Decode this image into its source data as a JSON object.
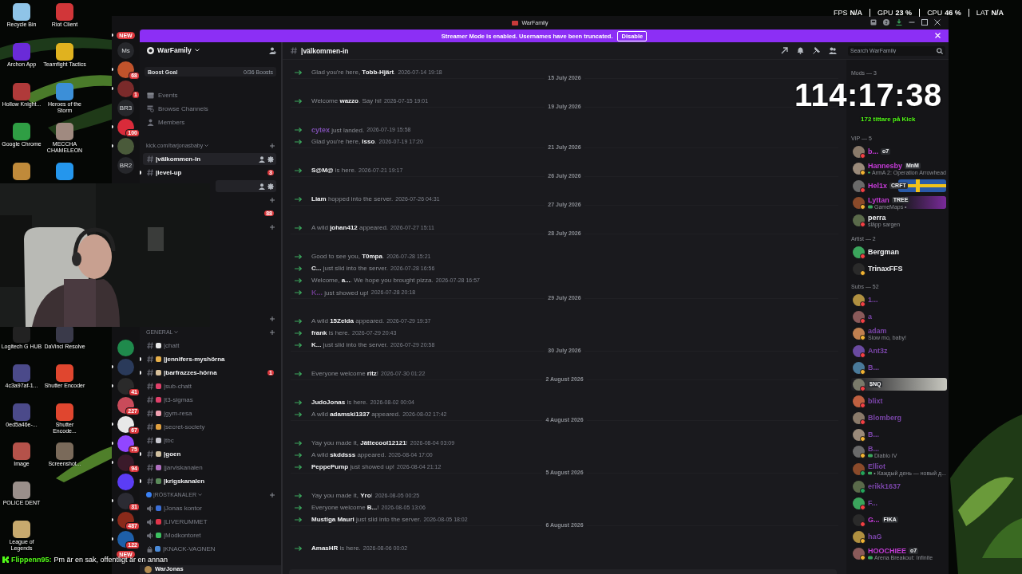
{
  "desktop": {
    "top_icons": [
      {
        "label": "Recycle Bin",
        "color": "#8fc4e8"
      },
      {
        "label": "Archon App",
        "color": "#6a2bd8"
      },
      {
        "label": "Hollow Knight...",
        "color": "#b03a3a"
      },
      {
        "label": "Google Chrome",
        "color": "#2f9e44"
      },
      {
        "color": "#c08a3a"
      },
      {
        "label": "Riot Client",
        "color": "#d13639"
      },
      {
        "label": "Teamfight Tactics",
        "color": "#e0b21f"
      },
      {
        "label": "Heroes of the Storm",
        "color": "#3c8fd8"
      },
      {
        "label": "MECCHA CHAMELEON",
        "color": "#a08a80"
      },
      {
        "color": "#2496ed"
      }
    ],
    "bottom_icons": [
      {
        "label": "Logitech G HUB",
        "color": "#222222"
      },
      {
        "label": "4c3a97af-1...",
        "color": "#4b4a8a"
      },
      {
        "label": "0ed5a46e-...",
        "color": "#4b4a8a"
      },
      {
        "label": "Image",
        "color": "#b5524a"
      },
      {
        "label": "POLICE DENT",
        "color": "#9a8f8a"
      },
      {
        "label": "League of Legends",
        "color": "#c8aa6e"
      },
      {
        "label": "DaVinci Resolve",
        "color": "#3a3a4a"
      },
      {
        "label": "Shutter Encoder",
        "color": "#e0462f"
      },
      {
        "label": "Shutter Encode...",
        "color": "#e0462f"
      },
      {
        "label": "Screenshot...",
        "color": "#7a6a5a"
      }
    ]
  },
  "window": {
    "title": "WarFamily"
  },
  "banner": {
    "text": "Streamer Mode is enabled. Usernames have been truncated.",
    "button": "Disable"
  },
  "server_rail": {
    "upper": [
      {
        "kind": "pill",
        "label": "NEW",
        "unread": true
      },
      {
        "kind": "text",
        "label": "Ms",
        "unread": false
      },
      {
        "kind": "avatar",
        "color": "#c0532b",
        "badge": "68",
        "unread": true
      },
      {
        "kind": "avatar",
        "color": "#7a2a2a",
        "badge": "1",
        "unread": true
      },
      {
        "kind": "text",
        "label": "BR3",
        "unread": false
      },
      {
        "kind": "avatar",
        "color": "#d92b3a",
        "badge": "100",
        "unread": true
      },
      {
        "kind": "avatar",
        "color": "#4a5a3a",
        "unread": true
      },
      {
        "kind": "text",
        "label": "BR2",
        "unread": false
      }
    ],
    "lower": [
      {
        "kind": "avatar",
        "color": "#1f8a4c",
        "unread": false
      },
      {
        "kind": "avatar",
        "color": "#2a3a5a",
        "unread": true
      },
      {
        "kind": "avatar",
        "color": "#2a2a2a",
        "badge": "41",
        "unread": true
      },
      {
        "kind": "avatar",
        "color": "#c94b5a",
        "badge": "227",
        "unread": false
      },
      {
        "kind": "avatar",
        "color": "#e8e8e8",
        "badge": "67",
        "unread": true
      },
      {
        "kind": "avatar",
        "color": "#9146ff",
        "badge": "75",
        "unread": true
      },
      {
        "kind": "avatar",
        "color": "#3a1a2a",
        "badge": "94",
        "unread": true
      },
      {
        "kind": "avatar",
        "color": "#5b3df5",
        "unread": false
      },
      {
        "kind": "avatar",
        "color": "#2b2b33",
        "badge": "31",
        "unread": true
      },
      {
        "kind": "avatar",
        "color": "#8a2a1a",
        "badge": "487",
        "unread": true
      },
      {
        "kind": "avatar",
        "color": "#1e5fa8",
        "badge": "122",
        "unread": true
      },
      {
        "kind": "pill",
        "label": "NEW",
        "unread": false
      }
    ]
  },
  "sidebar": {
    "server_name": "WarFamily",
    "boost": {
      "label": "Boost Goal",
      "progress": "0/36 Boosts",
      "level": 0
    },
    "nav": [
      {
        "kind": "events",
        "label": "Events"
      },
      {
        "kind": "browse",
        "label": "Browse Channels"
      },
      {
        "kind": "members",
        "label": "Members"
      }
    ],
    "upper": [
      {
        "kind": "category",
        "label": "kick.com/barjonasbaby"
      },
      {
        "kind": "channel",
        "name": "|välkommen-in",
        "selected": true,
        "unread": false
      },
      {
        "kind": "channel",
        "name": "|level-up",
        "selected": false,
        "unread": true,
        "badge": "3"
      },
      {
        "kind": "hover-row"
      },
      {
        "kind": "add-row"
      },
      {
        "kind": "badge-row",
        "badge": "88"
      },
      {
        "kind": "add-row"
      }
    ],
    "lower": [
      {
        "kind": "add-row"
      },
      {
        "kind": "category",
        "label": "GENERAL"
      },
      {
        "kind": "channel",
        "name": "|chatt",
        "color": "#e8e8e8",
        "selected": false,
        "unread": false
      },
      {
        "kind": "channel",
        "name": "|jennifers-myshörna",
        "color": "#e8b04a",
        "selected": false,
        "unread": true
      },
      {
        "kind": "channel",
        "name": "|barfrazzes-hörna",
        "color": "#d8c09a",
        "selected": false,
        "unread": true,
        "badge": "1"
      },
      {
        "kind": "channel",
        "name": "|sub-chatt",
        "color": "#e0406a",
        "selected": false,
        "unread": false
      },
      {
        "kind": "channel",
        "name": "|t3-sigmas",
        "color": "#e0406a",
        "selected": false,
        "unread": false
      },
      {
        "kind": "channel",
        "name": "|gym-resa",
        "color": "#f0a0b0",
        "selected": false,
        "unread": false
      },
      {
        "kind": "channel",
        "name": "|secret-society",
        "color": "#e0a040",
        "selected": false,
        "unread": false
      },
      {
        "kind": "channel",
        "name": "|tbc",
        "color": "#c8c8d0",
        "selected": false,
        "unread": false
      },
      {
        "kind": "channel",
        "name": "|goen",
        "color": "#d0c0a0",
        "selected": false,
        "unread": true
      },
      {
        "kind": "channel",
        "name": "|jarviskanalen",
        "color": "#b070c0",
        "selected": false,
        "unread": false
      },
      {
        "kind": "channel",
        "name": "|krigskanalen",
        "color": "#5a8a5a",
        "selected": false,
        "unread": true
      },
      {
        "kind": "category",
        "label": "|RÖSTKANALER",
        "color": "#3b82f6"
      },
      {
        "kind": "voice",
        "name": "|Jonas kontor",
        "color": "#3b6fd8",
        "selected": false,
        "unread": false
      },
      {
        "kind": "voice",
        "name": "|LIVERUMMET",
        "color": "#e0354a",
        "selected": false,
        "unread": false
      },
      {
        "kind": "voice",
        "name": "|Modkontoret",
        "color": "#3cc060",
        "selected": false,
        "unread": false
      },
      {
        "kind": "locked",
        "name": "|KNACK-VAGNEN",
        "color": "#4a8ad8",
        "selected": false,
        "unread": false
      }
    ],
    "user": "WarJonas"
  },
  "channel_header": {
    "name": "|välkommen-in",
    "search_placeholder": "Search WarFamily"
  },
  "messages": [
    {
      "kind": "join",
      "before": "Glad you're here, ",
      "name": "Tobb-Hjärt",
      "after": ".",
      "time": "2026-07-14 19:18"
    },
    {
      "kind": "date",
      "label": "15 July 2026"
    },
    {
      "kind": "join",
      "before": "Welcome ",
      "name": "wazzo",
      "after": ". Say hi!",
      "time": "2026-07-15 19:01"
    },
    {
      "kind": "date",
      "label": "19 July 2026"
    },
    {
      "kind": "join",
      "name": "cytex",
      "after": " just landed.",
      "time": "2026-07-19 15:58",
      "color": "#7d4fb0"
    },
    {
      "kind": "join",
      "before": "Glad you're here, ",
      "name": "Isso",
      "after": ".",
      "time": "2026-07-19 17:20"
    },
    {
      "kind": "date",
      "label": "21 July 2026"
    },
    {
      "kind": "join",
      "name": "S@M@",
      "after": " is here.",
      "time": "2026-07-21 19:17"
    },
    {
      "kind": "date",
      "label": "26 July 2026"
    },
    {
      "kind": "join",
      "name": "Liam",
      "after": " hopped into the server.",
      "time": "2026-07-26 04:31"
    },
    {
      "kind": "date",
      "label": "27 July 2026"
    },
    {
      "kind": "join",
      "before": "A wild ",
      "name": "johan412",
      "after": " appeared.",
      "time": "2026-07-27 15:11"
    },
    {
      "kind": "date",
      "label": "28 July 2026"
    },
    {
      "kind": "join",
      "before": "Good to see you, ",
      "name": "T0mpa",
      "after": ".",
      "time": "2026-07-28 15:21"
    },
    {
      "kind": "join",
      "name": "C...",
      "after": " just slid into the server.",
      "time": "2026-07-28 16:56"
    },
    {
      "kind": "join",
      "before": "Welcome, ",
      "name": "a...",
      "after": ". We hope you brought pizza.",
      "time": "2026-07-28 16:57"
    },
    {
      "kind": "join",
      "name": "K...",
      "after": " just showed up!",
      "time": "2026-07-28 20:18",
      "color": "#6a3a8a"
    },
    {
      "kind": "date",
      "label": "29 July 2026"
    },
    {
      "kind": "join",
      "before": "A wild ",
      "name": "15Zelda",
      "after": " appeared.",
      "time": "2026-07-29 19:37"
    },
    {
      "kind": "join",
      "name": "frank",
      "after": " is here.",
      "time": "2026-07-29 20:43"
    },
    {
      "kind": "join",
      "name": "K...",
      "after": " just slid into the server.",
      "time": "2026-07-29 20:58"
    },
    {
      "kind": "date",
      "label": "30 July 2026"
    },
    {
      "kind": "join",
      "before": "Everyone welcome ",
      "name": "ritz",
      "after": "!",
      "time": "2026-07-30 01:22"
    },
    {
      "kind": "date",
      "label": "2 August 2026"
    },
    {
      "kind": "join",
      "name": "JudoJonas",
      "after": " is here.",
      "time": "2026-08-02 00:04"
    },
    {
      "kind": "join",
      "before": "A wild ",
      "name": "adamski1337",
      "after": " appeared.",
      "time": "2026-08-02 17:42"
    },
    {
      "kind": "date",
      "label": "4 August 2026"
    },
    {
      "kind": "join",
      "before": "Yay you made it, ",
      "name": "Jättecool12121",
      "after": "!",
      "time": "2026-08-04 03:09"
    },
    {
      "kind": "join",
      "before": "A wild ",
      "name": "skddsss",
      "after": " appeared.",
      "time": "2026-08-04 17:00"
    },
    {
      "kind": "join",
      "name": "PeppePump",
      "after": " just showed up!",
      "time": "2026-08-04 21:12"
    },
    {
      "kind": "date",
      "label": "5 August 2026"
    },
    {
      "kind": "join",
      "before": "Yay you made it, ",
      "name": "Yro",
      "after": "!",
      "time": "2026-08-05 00:25"
    },
    {
      "kind": "join",
      "before": "Everyone welcome ",
      "name": "B...",
      "after": "!",
      "time": "2026-08-05 13:06"
    },
    {
      "kind": "join",
      "name": "Mustiga Mauri",
      "after": " just slid into the server.",
      "time": "2026-08-05 18:02"
    },
    {
      "kind": "date",
      "label": "6 August 2026"
    },
    {
      "kind": "join",
      "name": "AmasHR",
      "after": " is here.",
      "time": "2026-08-06 00:02"
    }
  ],
  "member_groups": [
    {
      "title": "Mods — 3"
    },
    {
      "title": "VIP — 5",
      "members": [
        {
          "name": "b...",
          "color": "#c43bd6",
          "tag": "o7",
          "status": {
            "color": "#f23f43"
          }
        },
        {
          "name": "Hannesby",
          "color": "#c43bd6",
          "tag": "MnM",
          "activity": "ArmA 2: Operation Arrowhead",
          "playing": true,
          "status": {
            "color": "#f0b232"
          }
        },
        {
          "name": "Hel1x",
          "color": "#c43bd6",
          "tag": "CRFT",
          "banner": {
            "kind": "flag"
          },
          "status": {
            "color": "#f23f43"
          }
        },
        {
          "name": "Lyttan",
          "color": "#c43bd6",
          "tag": "TREE",
          "activity": "GameMaps •",
          "playing": true,
          "banner": {
            "kind": "purple"
          },
          "status": {
            "color": "#f0b232"
          }
        },
        {
          "name": "perra",
          "color": "#f2f3f5",
          "activity": "släpp sargen",
          "playing": false,
          "status": {
            "color": "#f23f43"
          }
        }
      ]
    },
    {
      "title": "Artist — 2",
      "members": [
        {
          "name": "Bergman",
          "color": "#f2f3f5",
          "status": {
            "color": "#f23f43"
          }
        },
        {
          "name": "TrinaxFFS",
          "color": "#f2f3f5",
          "status": {
            "color": "#f0b232"
          }
        }
      ]
    },
    {
      "title": "Subs — 52",
      "members": [
        {
          "name": "1...",
          "color": "#7a45a8",
          "status": {
            "color": "#f23f43"
          }
        },
        {
          "name": "a",
          "color": "#7a45a8",
          "status": {
            "color": "#f23f43"
          }
        },
        {
          "name": "adam",
          "color": "#7a45a8",
          "activity": "Slow mo, baby!",
          "playing": false,
          "status": {
            "color": "#f0b232"
          }
        },
        {
          "name": "Ant3z",
          "color": "#7a45a8",
          "status": {
            "color": "#f23f43"
          }
        },
        {
          "name": "B...",
          "color": "#7a45a8",
          "status": {
            "color": "#f0b232"
          }
        },
        {
          "tag": "$NQ",
          "banner": {
            "kind": "grey"
          },
          "status": {
            "color": "#f23f43"
          }
        },
        {
          "name": "blixt",
          "color": "#7a45a8",
          "status": {
            "color": "#f23f43"
          }
        },
        {
          "name": "Blomberg",
          "color": "#7a45a8",
          "status": {
            "color": "#f23f43"
          }
        },
        {
          "name": "B...",
          "color": "#7a45a8",
          "status": {
            "color": "#f0b232"
          }
        },
        {
          "name": "B...",
          "color": "#7a45a8",
          "activity": "Diablo IV",
          "playing": true,
          "status": {
            "color": "#f0b232"
          }
        },
        {
          "name": "Elliot",
          "color": "#7a45a8",
          "activity": "• Каждый день — новый д...",
          "playing": true,
          "status": {
            "color": "#23a55a"
          }
        },
        {
          "name": "erikk1637",
          "color": "#7a45a8",
          "status": {
            "color": "#23a55a"
          }
        },
        {
          "name": "F...",
          "color": "#7a45a8",
          "status": {
            "color": "#f23f43"
          }
        },
        {
          "name": "G...",
          "color": "#c43bd6",
          "tag": "FIKA",
          "status": {
            "color": "#f23f43"
          }
        },
        {
          "name": "haG",
          "color": "#7a45a8",
          "status": {
            "color": "#f0b232"
          }
        },
        {
          "name": "HOOCHIEE",
          "color": "#c43bd6",
          "tag": "o7",
          "activity": "Arena Breakout: Infinite",
          "playing": true,
          "status": {
            "color": "#f0b232"
          }
        }
      ]
    }
  ],
  "overlay": {
    "timer": "114:17:38",
    "viewers": "172 tittare på Kick",
    "stats": [
      {
        "label": "FPS",
        "value": "N/A"
      },
      {
        "label": "GPU",
        "value": "23 %"
      },
      {
        "label": "CPU",
        "value": "46 %"
      },
      {
        "label": "LAT",
        "value": "N/A"
      }
    ],
    "chat": {
      "user": "Flippenn95:",
      "text": "Pm är en sak, offentligt är en annan"
    }
  }
}
